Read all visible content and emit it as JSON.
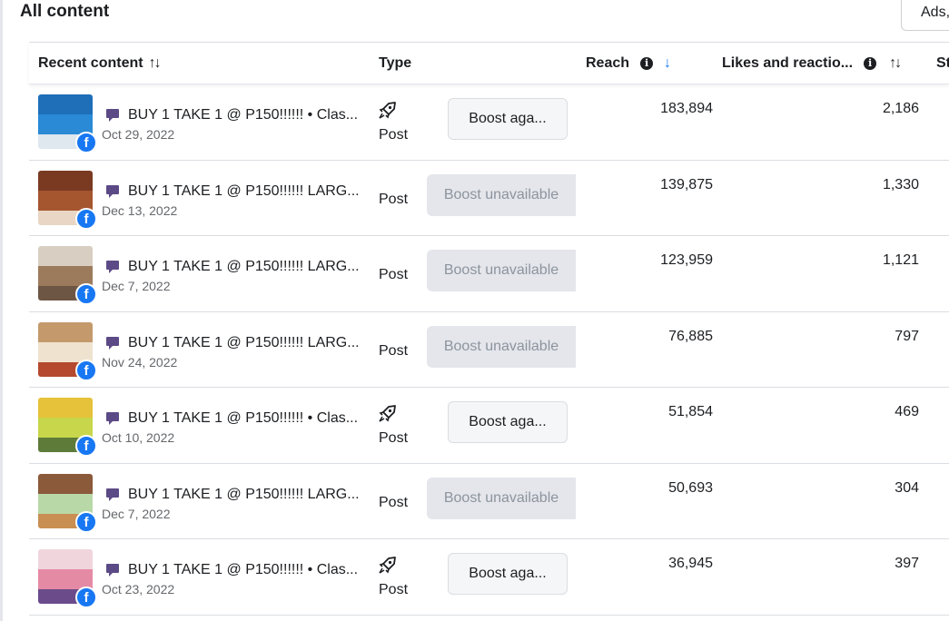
{
  "page": {
    "title": "All content",
    "ads_button": "Ads,"
  },
  "table": {
    "columns": {
      "recent": "Recent content",
      "recent_sort": "↑↓",
      "type": "Type",
      "reach": "Reach",
      "reach_sort": "↓",
      "likes": "Likes and reactio...",
      "likes_sort": "↑↓",
      "next": "St"
    },
    "rows": [
      {
        "title": "BUY 1 TAKE 1 @ P150!!!!!! • Clas...",
        "date": "Oct 29, 2022",
        "type": "Post",
        "boost": "Boost aga...",
        "boost_enabled": true,
        "reach": "183,894",
        "likes": "2,186",
        "thumb_colors": [
          "#1e6fb8",
          "#2a8ad6",
          "#dfe7ef"
        ]
      },
      {
        "title": "BUY 1 TAKE 1 @ P150!!!!!! LARG...",
        "date": "Dec 13, 2022",
        "type": "Post",
        "boost": "Boost unavailable",
        "boost_enabled": false,
        "reach": "139,875",
        "likes": "1,330",
        "thumb_colors": [
          "#7a3a22",
          "#a5562f",
          "#e9d6c4"
        ]
      },
      {
        "title": "BUY 1 TAKE 1 @ P150!!!!!! LARG...",
        "date": "Dec 7, 2022",
        "type": "Post",
        "boost": "Boost unavailable",
        "boost_enabled": false,
        "reach": "123,959",
        "likes": "1,121",
        "thumb_colors": [
          "#d8cfc2",
          "#9c7b5c",
          "#6e5645"
        ]
      },
      {
        "title": "BUY 1 TAKE 1 @ P150!!!!!! LARG...",
        "date": "Nov 24, 2022",
        "type": "Post",
        "boost": "Boost unavailable",
        "boost_enabled": false,
        "reach": "76,885",
        "likes": "797",
        "thumb_colors": [
          "#c49a6c",
          "#efe3cf",
          "#b4492f"
        ]
      },
      {
        "title": "BUY 1 TAKE 1 @ P150!!!!!! • Clas...",
        "date": "Oct 10, 2022",
        "type": "Post",
        "boost": "Boost aga...",
        "boost_enabled": true,
        "reach": "51,854",
        "likes": "469",
        "thumb_colors": [
          "#e5c23a",
          "#c7d64a",
          "#5e7b3a"
        ]
      },
      {
        "title": "BUY 1 TAKE 1 @ P150!!!!!! LARG...",
        "date": "Dec 7, 2022",
        "type": "Post",
        "boost": "Boost unavailable",
        "boost_enabled": false,
        "reach": "50,693",
        "likes": "304",
        "thumb_colors": [
          "#8a5a3a",
          "#b9d8a7",
          "#c98e52"
        ]
      },
      {
        "title": "BUY 1 TAKE 1 @ P150!!!!!! • Clas...",
        "date": "Oct 23, 2022",
        "type": "Post",
        "boost": "Boost aga...",
        "boost_enabled": true,
        "reach": "36,945",
        "likes": "397",
        "thumb_colors": [
          "#f0d5dd",
          "#e58aa5",
          "#6b4b8a"
        ]
      }
    ]
  },
  "icons": {
    "facebook_badge": "f",
    "info": "i"
  },
  "colors": {
    "accent": "#1877f2",
    "post_icon": "#5b4a86",
    "disabled_bg": "#e4e6eb"
  }
}
